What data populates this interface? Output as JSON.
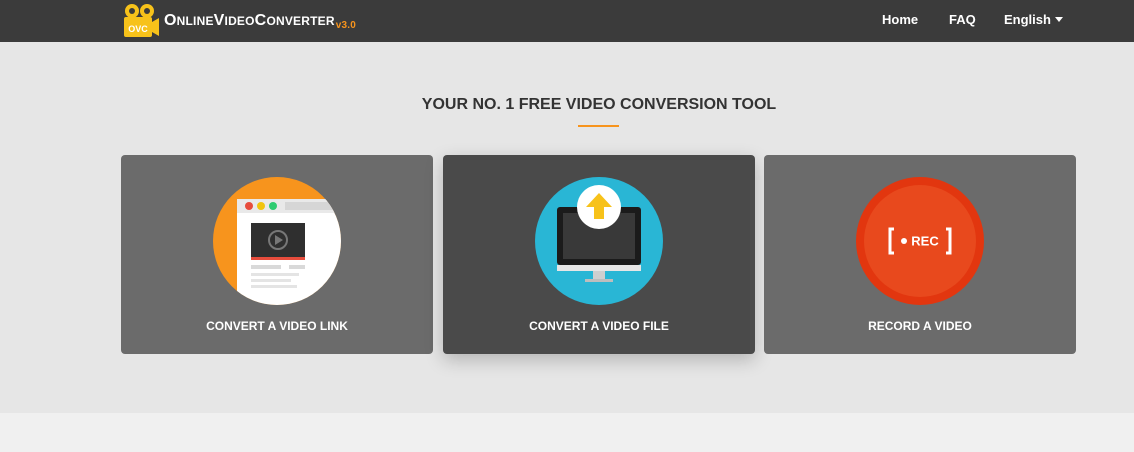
{
  "header": {
    "logo_icon_text": "OVC",
    "brand": {
      "o": "O",
      "nline": "NLINE",
      "v": "V",
      "ideo": "IDEO",
      "c": "C",
      "onverter": "ONVERTER",
      "version": "v3.0"
    },
    "nav": [
      {
        "label": "Home"
      },
      {
        "label": "FAQ"
      },
      {
        "label": "English"
      }
    ]
  },
  "hero": {
    "title": "YOUR NO. 1 FREE VIDEO CONVERSION TOOL",
    "accent_color": "#f7941d",
    "cards": [
      {
        "label": "CONVERT A VIDEO LINK",
        "icon": "browser-video-icon",
        "circle_color": "#f7941d"
      },
      {
        "label": "CONVERT A VIDEO FILE",
        "icon": "monitor-upload-icon",
        "circle_color": "#29b6d5",
        "active": true
      },
      {
        "label": "RECORD A VIDEO",
        "icon": "rec-icon",
        "icon_text": "REC",
        "circle_color": "#e2360f"
      }
    ]
  }
}
